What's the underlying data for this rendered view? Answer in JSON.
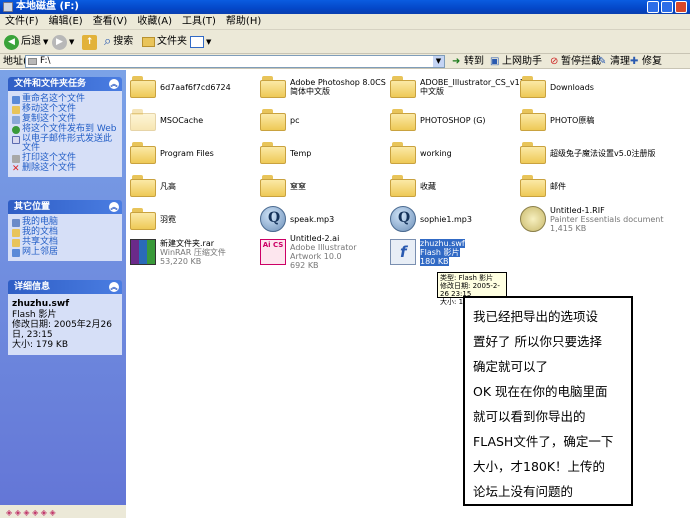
{
  "window": {
    "title": "本地磁盘 (F:)"
  },
  "menu": [
    "文件(F)",
    "编辑(E)",
    "查看(V)",
    "收藏(A)",
    "工具(T)",
    "帮助(H)"
  ],
  "toolbar": {
    "back": "后退",
    "search": "搜索",
    "folders": "文件夹"
  },
  "address": {
    "label": "地址(D)",
    "path": "F:\\"
  },
  "quicklinks": {
    "go": "转到",
    "online_help": "上网助手",
    "block_popups": "暂停拦截",
    "clean": "清理",
    "repair": "修复"
  },
  "sidebar": {
    "tasks": {
      "title": "文件和文件夹任务",
      "items": [
        "重命名这个文件",
        "移动这个文件",
        "复制这个文件",
        "将这个文件发布到 Web",
        "以电子邮件形式发送此文件",
        "打印这个文件",
        "删除这个文件"
      ]
    },
    "places": {
      "title": "其它位置",
      "items": [
        "我的电脑",
        "我的文档",
        "共享文档",
        "网上邻居"
      ]
    },
    "details": {
      "title": "详细信息",
      "name": "zhuzhu.swf",
      "type": "Flash 影片",
      "modified": "修改日期: 2005年2月26日, 23:15",
      "size": "大小: 179 KB"
    }
  },
  "files": [
    {
      "name": "6d7aaf6f7cd6724"
    },
    {
      "name": "Adobe Photoshop 8.0CS简体中文版"
    },
    {
      "name": "ADOBE_Illustrator_CS_v11.0中文版"
    },
    {
      "name": "Downloads"
    },
    {
      "name": "MSOCache"
    },
    {
      "name": "pc"
    },
    {
      "name": "PHOTOSHOP (G)"
    },
    {
      "name": "PHOTO原稿"
    },
    {
      "name": "Program Files"
    },
    {
      "name": "Temp"
    },
    {
      "name": "working"
    },
    {
      "name": "超级兔子魔法设置v5.0注册版"
    },
    {
      "name": "凡高"
    },
    {
      "name": "窒窒"
    },
    {
      "name": "收藏"
    },
    {
      "name": "邮件"
    },
    {
      "name": "羽霓"
    },
    {
      "name": "speak.mp3"
    },
    {
      "name": "sophie1.mp3"
    },
    {
      "name": "Untitled-1.RIF",
      "sub1": "Painter Essentials document",
      "sub2": "1,415 KB"
    },
    {
      "name": "新建文件夹.rar",
      "sub1": "WinRAR 压缩文件",
      "sub2": "53,220 KB"
    },
    {
      "name": "Untitled-2.ai",
      "sub1": "Adobe Illustrator Artwork 10.0",
      "sub2": "692 KB"
    },
    {
      "name": "zhuzhu.swf",
      "sub1": "Flash 影片",
      "sub2": "180 KB"
    }
  ],
  "icons": {
    "mp3": "winamp-icon",
    "rif": "painter-icon",
    "rar": "winrar-icon",
    "ai": "illustrator-icon",
    "swf": "flash-icon",
    "ai_badge": "Ai CS"
  },
  "tooltip": {
    "type": "类型: Flash 影片",
    "modified": "修改日期: 2005-2-26 23:15",
    "size": "大小: 179 KB"
  },
  "note": {
    "lines": [
      "我已经把导出的选项设",
      "置好了 所以你只要选择",
      "确定就可以了",
      "OK 现在在你的电脑里面",
      "就可以看到你导出的",
      "FLASH文件了，确定一下",
      "大小，才180K！上传的",
      "论坛上没有问题的"
    ]
  }
}
